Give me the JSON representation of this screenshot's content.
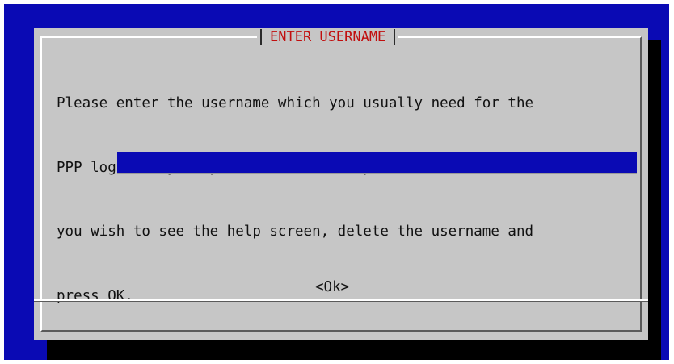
{
  "dialog": {
    "title": "ENTER USERNAME",
    "message_lines": [
      "Please enter the username which you usually need for the",
      "PPP login to your provider in the input box below. If",
      "you wish to see the help screen, delete the username and",
      "press OK."
    ],
    "input_value": "",
    "ok_label": "<Ok>"
  },
  "colors": {
    "screen_background": "#0a0ab4",
    "dialog_background": "#c6c6c6",
    "title_text": "#c10e0e",
    "input_background": "#0a0ab4",
    "shadow": "#000000"
  }
}
